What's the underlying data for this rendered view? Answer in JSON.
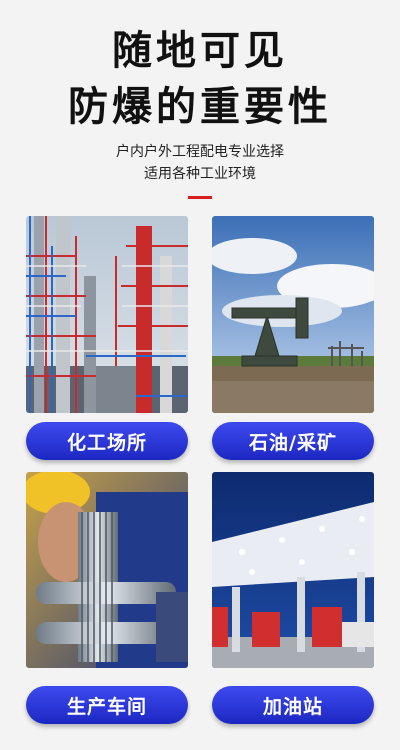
{
  "header": {
    "title_line1": "随地可见",
    "title_line2": "防爆的重要性",
    "subtitle_line1": "户内户外工程配电专业选择",
    "subtitle_line2": "适用各种工业环境"
  },
  "scenes": [
    {
      "label": "化工场所",
      "image": "chemical-plant"
    },
    {
      "label": "石油/采矿",
      "image": "oil-pumpjack"
    },
    {
      "label": "生产车间",
      "image": "factory-worker-gears"
    },
    {
      "label": "加油站",
      "image": "gas-station"
    }
  ],
  "colors": {
    "accent_red": "#d81e1e",
    "button_blue": "#2a35d8"
  }
}
